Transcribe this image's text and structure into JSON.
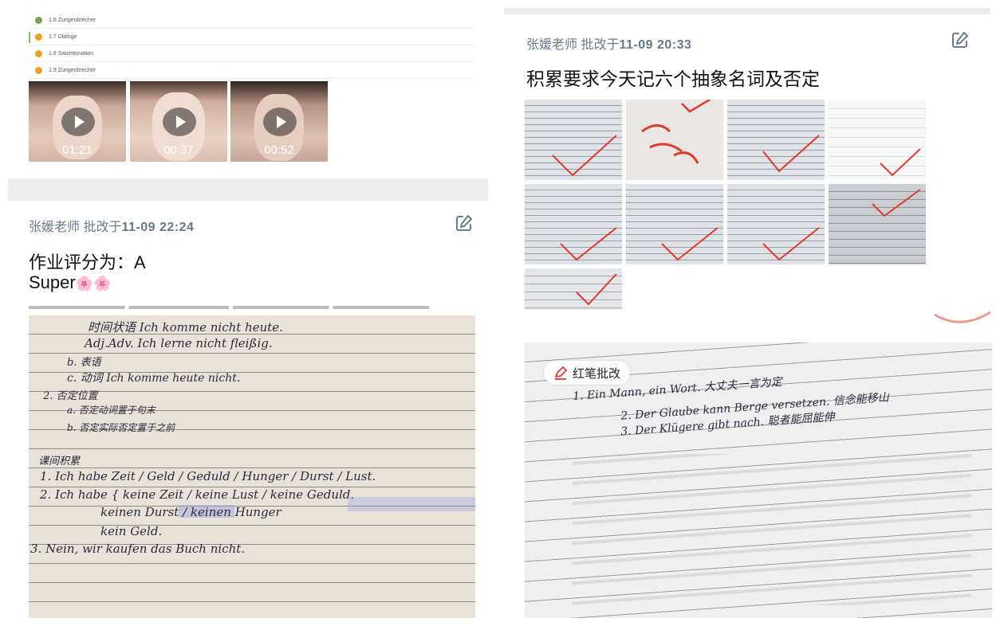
{
  "lesson_list": [
    {
      "number": "1.6",
      "title": "Zungenbrecher",
      "status_color": "#7aa24c"
    },
    {
      "number": "1.7",
      "title": "Dialoge",
      "status_color": "#f0a020"
    },
    {
      "number": "1.8",
      "title": "Satzintonation",
      "status_color": "#f0a020"
    },
    {
      "number": "1.9",
      "title": "Zungenbrecher",
      "status_color": "#f0a020"
    }
  ],
  "videos": [
    {
      "duration": "01:21"
    },
    {
      "duration": "00:37"
    },
    {
      "duration": "00:52"
    }
  ],
  "review_left": {
    "teacher": "张媛老师",
    "action": "批改于",
    "timestamp": "11-09 22:24",
    "comment_line1": "作业评分为：A",
    "comment_line2": "Super",
    "emoji": "🌸🌸"
  },
  "review_right": {
    "teacher": "张媛老师",
    "action": "批改于",
    "timestamp": "11-09 20:33",
    "comment": "积累要求今天记六个抽象名词及否定",
    "red_pen_label": "红笔批改"
  },
  "notebook_left": [
    "时间状语   Ich komme nicht heute.",
    "Adj.Adv.   Ich lerne nicht fleißig.",
    "b. 表语",
    "c. 动词      Ich komme heute nicht.",
    "2.  否定位置",
    "a. 否定动词置于句末",
    "b. 否定实际否定置于之前",
    "",
    "课间积累",
    "1. Ich habe Zeit / Geld / Geduld / Hunger / Durst / Lust.",
    "2. Ich habe { keine Zeit / keine Lust / keine Geduld.",
    "     keinen Durst / keinen Hunger",
    "     kein Geld.",
    "3. Nein, wir kaufen das Buch nicht."
  ],
  "notebook_right": [
    "1.   Ein Mann, ein Wort. 大丈夫一言为定",
    "2.   Der Glaube kann Berge versetzen. 信念能移山",
    "3.   Der Klügere gibt nach. 聪者能屈能伸"
  ],
  "colors": {
    "teacher_text": "#6b7a8c",
    "red_check": "#e03a2c",
    "page_bg": "#ffffff",
    "band": "#ececec"
  }
}
